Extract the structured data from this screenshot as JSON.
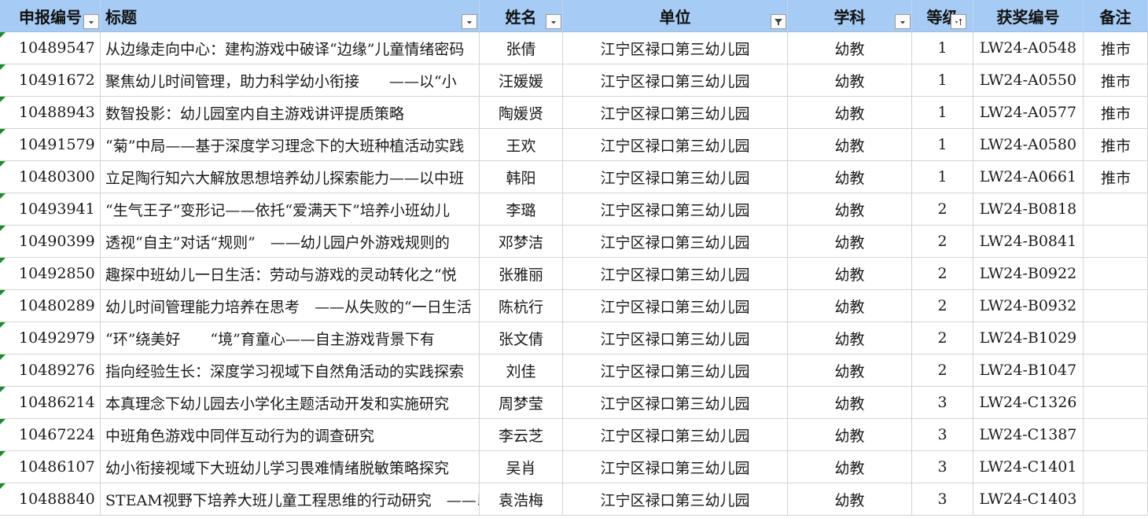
{
  "sheet": {
    "headers": [
      {
        "label": "申报编号",
        "filter": "dropdown"
      },
      {
        "label": "标题",
        "filter": "dropdown"
      },
      {
        "label": "姓名",
        "filter": "dropdown"
      },
      {
        "label": "单位",
        "filter": "filtered"
      },
      {
        "label": "学科",
        "filter": "dropdown"
      },
      {
        "label": "等级",
        "filter": "sorted-asc"
      },
      {
        "label": "获奖编号",
        "filter": "none"
      },
      {
        "label": "备注",
        "filter": "none"
      }
    ],
    "rows": [
      [
        "10489547",
        "从边缘走向中心：建构游戏中破译“边缘”儿童情绪密码",
        "张倩",
        "江宁区禄口第三幼儿园",
        "幼教",
        "1",
        "LW24-A0548",
        "推市"
      ],
      [
        "10491672",
        "聚焦幼儿时间管理，助力科学幼小衔接　　——以“小",
        "汪媛媛",
        "江宁区禄口第三幼儿园",
        "幼教",
        "1",
        "LW24-A0550",
        "推市"
      ],
      [
        "10488943",
        "数智投影：幼儿园室内自主游戏讲评提质策略",
        "陶媛贤",
        "江宁区禄口第三幼儿园",
        "幼教",
        "1",
        "LW24-A0577",
        "推市"
      ],
      [
        "10491579",
        "“菊”中局——基于深度学习理念下的大班种植活动实践",
        "王欢",
        "江宁区禄口第三幼儿园",
        "幼教",
        "1",
        "LW24-A0580",
        "推市"
      ],
      [
        "10480300",
        "立足陶行知六大解放思想培养幼儿探索能力——以中班",
        "韩阳",
        "江宁区禄口第三幼儿园",
        "幼教",
        "1",
        "LW24-A0661",
        "推市"
      ],
      [
        "10493941",
        "“生气王子”变形记——依托“爱满天下”培养小班幼儿",
        "李璐",
        "江宁区禄口第三幼儿园",
        "幼教",
        "2",
        "LW24-B0818",
        ""
      ],
      [
        "10490399",
        "透视“自主”对话“规则”　——幼儿园户外游戏规则的",
        "邓梦洁",
        "江宁区禄口第三幼儿园",
        "幼教",
        "2",
        "LW24-B0841",
        ""
      ],
      [
        "10492850",
        "趣探中班幼儿一日生活：劳动与游戏的灵动转化之“悦",
        "张雅丽",
        "江宁区禄口第三幼儿园",
        "幼教",
        "2",
        "LW24-B0922",
        ""
      ],
      [
        "10480289",
        "幼儿时间管理能力培养在思考　——从失败的“一日生活",
        "陈杭行",
        "江宁区禄口第三幼儿园",
        "幼教",
        "2",
        "LW24-B0932",
        ""
      ],
      [
        "10492979",
        "“环”绕美好　　“境”育童心——自主游戏背景下有",
        "张文倩",
        "江宁区禄口第三幼儿园",
        "幼教",
        "2",
        "LW24-B1029",
        ""
      ],
      [
        "10489276",
        "指向经验生长：深度学习视域下自然角活动的实践探索",
        "刘佳",
        "江宁区禄口第三幼儿园",
        "幼教",
        "2",
        "LW24-B1047",
        ""
      ],
      [
        "10486214",
        "本真理念下幼儿园去小学化主题活动开发和实施研究",
        "周梦莹",
        "江宁区禄口第三幼儿园",
        "幼教",
        "3",
        "LW24-C1326",
        ""
      ],
      [
        "10467224",
        "中班角色游戏中同伴互动行为的调查研究",
        "李云芝",
        "江宁区禄口第三幼儿园",
        "幼教",
        "3",
        "LW24-C1387",
        ""
      ],
      [
        "10486107",
        "幼小衔接视域下大班幼儿学习畏难情绪脱敏策略探究",
        "吴肖",
        "江宁区禄口第三幼儿园",
        "幼教",
        "3",
        "LW24-C1401",
        ""
      ],
      [
        "10488840",
        "STEAM视野下培养大班儿童工程思维的行动研究　——以",
        "袁浩梅",
        "江宁区禄口第三幼儿园",
        "幼教",
        "3",
        "LW24-C1403",
        ""
      ]
    ]
  },
  "colors": {
    "header_bg": "#a6cbf5",
    "grid": "#d4d4d4",
    "error_indicator": "#1e8a2e"
  },
  "icons": {
    "dropdown": "chevron-down-icon",
    "filtered": "filter-funnel-icon",
    "sorted-asc": "sort-ascending-icon"
  }
}
